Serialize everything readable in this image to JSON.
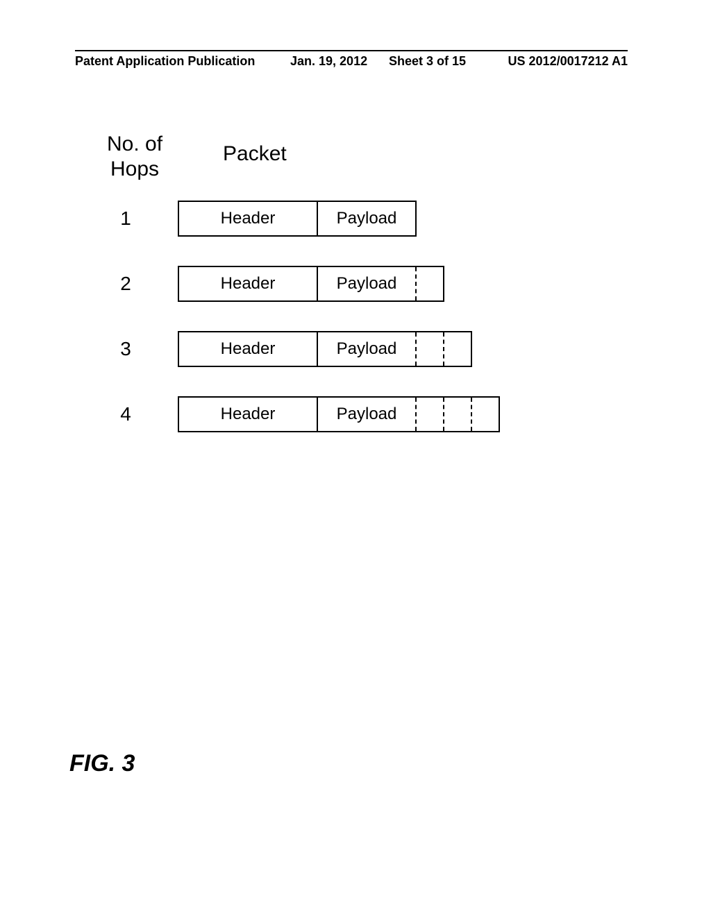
{
  "header": {
    "pub_type": "Patent Application Publication",
    "pub_date": "Jan. 19, 2012",
    "sheet_info": "Sheet 3 of 15",
    "pub_num": "US 2012/0017212 A1"
  },
  "columns": {
    "hops_label_line1": "No. of",
    "hops_label_line2": "Hops",
    "packet_label": "Packet"
  },
  "rows": [
    {
      "hop": "1",
      "header": "Header",
      "payload": "Payload",
      "tags": 0
    },
    {
      "hop": "2",
      "header": "Header",
      "payload": "Payload",
      "tags": 1
    },
    {
      "hop": "3",
      "header": "Header",
      "payload": "Payload",
      "tags": 2
    },
    {
      "hop": "4",
      "header": "Header",
      "payload": "Payload",
      "tags": 3
    }
  ],
  "figure_label": "FIG. 3"
}
